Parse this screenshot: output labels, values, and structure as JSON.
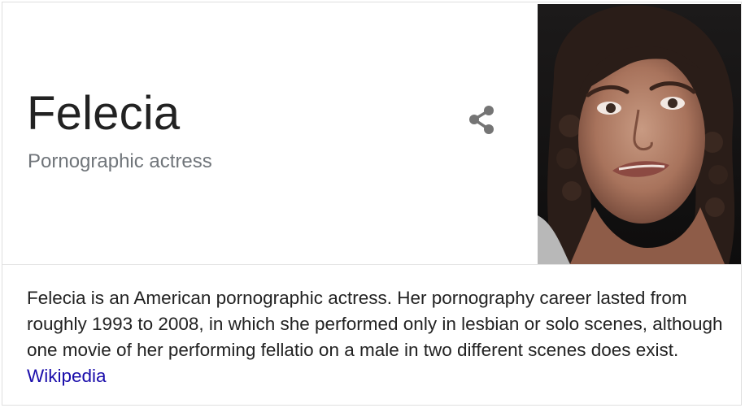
{
  "entity": {
    "title": "Felecia",
    "subtitle": "Pornographic actress"
  },
  "share": {
    "icon": "share-icon",
    "color": "#757575"
  },
  "photo": {
    "icon": "person-photo"
  },
  "description": {
    "text": "Felecia is an American pornographic actress. Her pornography career lasted from roughly 1993 to 2008, in which she performed only in lesbian or solo scenes, although one movie of her performing fellatio on a male in two different scenes does exist.",
    "source_link": "Wikipedia",
    "link_color": "#1a0dab"
  }
}
